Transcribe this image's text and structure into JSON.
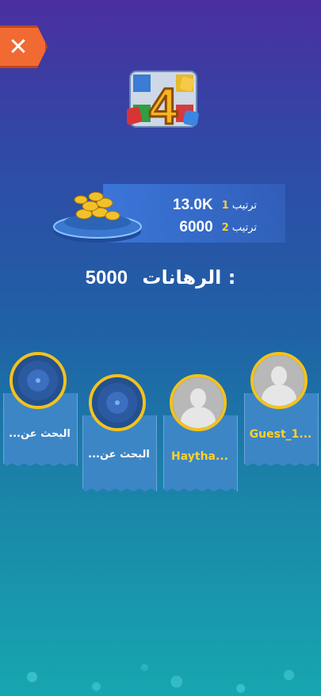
{
  "header": {
    "close_symbol": "✕",
    "game_badge_number": "4"
  },
  "reward": {
    "rank1": {
      "label": "ترتيب",
      "number": "1",
      "amount": "13.0K"
    },
    "rank2": {
      "label": "ترتيب",
      "number": "2",
      "amount": "6000"
    }
  },
  "bet": {
    "label": "الرهانات :",
    "amount": "5000"
  },
  "players": [
    {
      "name": "...البحث عن",
      "type": "searching"
    },
    {
      "name": "...البحث عن",
      "type": "searching"
    },
    {
      "name": "Haytha...",
      "type": "player"
    },
    {
      "name": "Guest_1...",
      "type": "player"
    }
  ],
  "colors": {
    "accent_gold": "#f3c21d",
    "close_orange": "#f06a32"
  }
}
